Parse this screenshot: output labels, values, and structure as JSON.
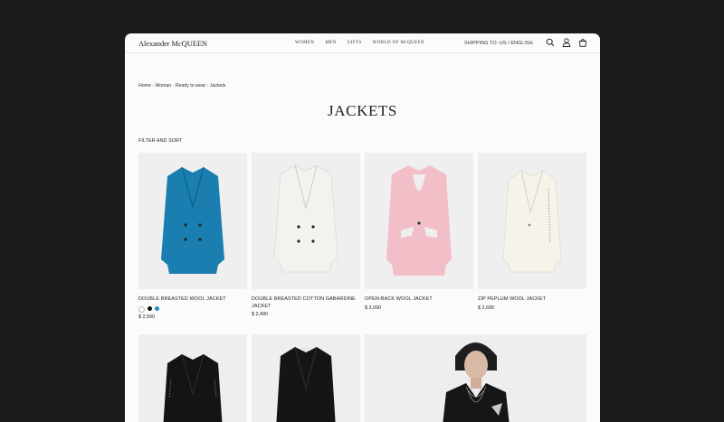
{
  "brand": {
    "logo": "Alexander McQUEEN"
  },
  "nav": {
    "items": [
      {
        "label": "WOMEN"
      },
      {
        "label": "MEN"
      },
      {
        "label": "GIFTS"
      },
      {
        "label": "WORLD OF McQUEEN"
      }
    ],
    "shipping": "SHIPPING TO: US / ENGLISH"
  },
  "icons": [
    "search-icon",
    "account-icon",
    "bag-icon"
  ],
  "breadcrumb": "Home - Woman - Ready to wear - Jackets",
  "page": {
    "title": "JACKETS",
    "filter_label": "FILTER AND SORT"
  },
  "products": [
    {
      "name": "DOUBLE BREASTED WOOL JACKET",
      "price": "$ 2,590",
      "jacket_color": "#1a7fb0",
      "swatches": [
        "#ffffff",
        "#111111",
        "#1a8fc0"
      ]
    },
    {
      "name": "DOUBLE BREASTED COTTON GABARDINE JACKET",
      "price": "$ 2,490",
      "jacket_color": "#f4f2ee",
      "swatches": []
    },
    {
      "name": "OPEN-BACK WOOL JACKET",
      "price": "$ 3,090",
      "jacket_color": "#f2bfc8",
      "swatches": []
    },
    {
      "name": "ZIP PEPLUM WOOL JACKET",
      "price": "$ 2,690",
      "jacket_color": "#f6f3ea",
      "swatches": []
    }
  ],
  "colors": {
    "page_bg": "#1b1a1c",
    "window_bg": "#fcfbfb",
    "image_bg": "#f0efef",
    "text": "#222222"
  }
}
